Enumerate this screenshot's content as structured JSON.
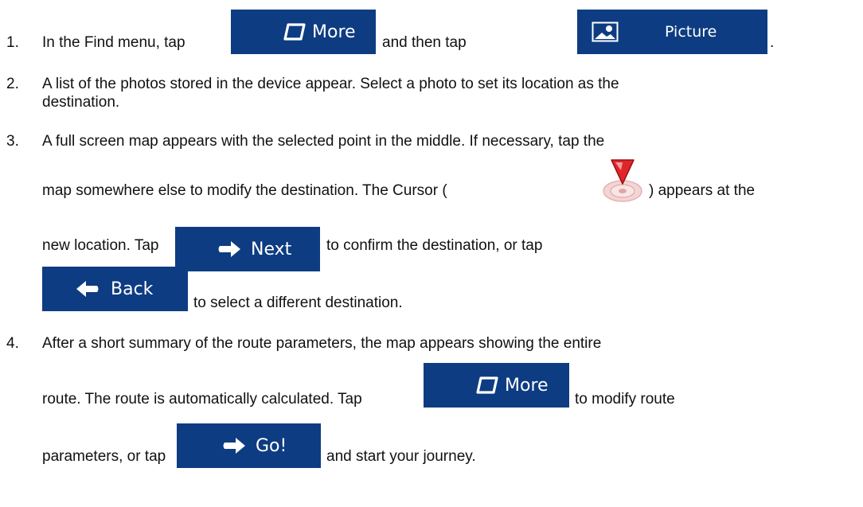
{
  "steps": [
    {
      "number": "1.",
      "line1_a": "In the Find menu, tap",
      "line1_b": "and then tap",
      "line1_c": "."
    },
    {
      "number": "2.",
      "line1": "A list of the photos stored in the device appear. Select a photo to set its location as the",
      "line2": "destination."
    },
    {
      "number": "3.",
      "line1": "A full screen map appears with the selected point in the middle. If necessary, tap the",
      "line2_a": "map somewhere else to modify the destination. The Cursor (",
      "line2_b": ") appears at the",
      "line3_a": "new location. Tap",
      "line3_b": "to confirm the destination, or tap",
      "line4": "to select a different destination."
    },
    {
      "number": "4.",
      "line1": "After a short summary of the route parameters, the map appears showing the entire",
      "line2_a": "route. The route is automatically calculated. Tap",
      "line2_b": "to modify route",
      "line3_a": "parameters, or tap",
      "line3_b": "and start your journey."
    }
  ],
  "buttons": {
    "more": "More",
    "picture": "Picture",
    "next": "Next",
    "back": "Back",
    "go": "Go!"
  },
  "icons": {
    "more": "more-icon",
    "picture": "picture-icon",
    "next": "arrow-right-icon",
    "back": "arrow-left-icon",
    "go": "arrow-right-icon",
    "cursor": "cursor-pin-icon"
  },
  "colors": {
    "button_bg": "#0d3c82",
    "button_text": "#ffffff",
    "cursor_red": "#e0262b"
  }
}
